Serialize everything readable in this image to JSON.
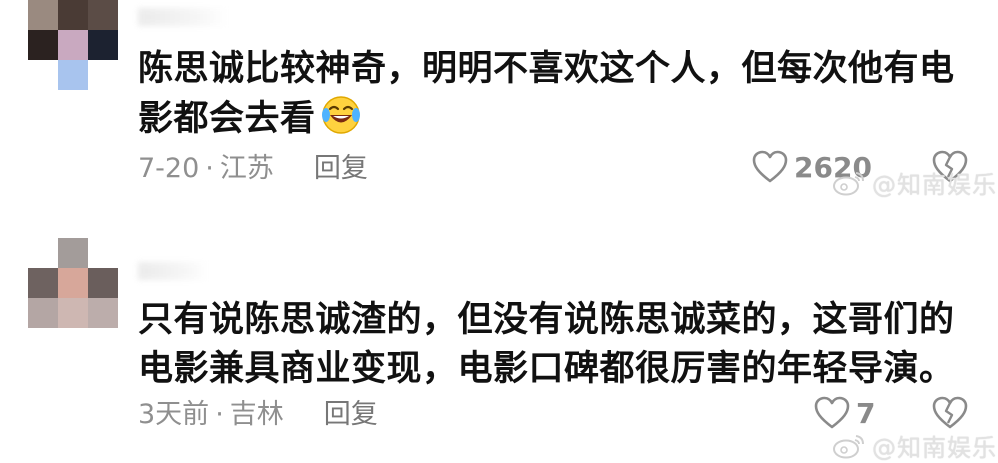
{
  "comments": [
    {
      "text_line1": "陈思诚比较神奇，明明不喜欢这个人，但每次他有电",
      "text_line2": "影都会去看",
      "emoji": "laughing-crying-emoji",
      "date": "7-20",
      "separator": "·",
      "location": "江苏",
      "reply_label": "回复",
      "like_count": "2620"
    },
    {
      "text_line1": "只有说陈思诚渣的，但没有说陈思诚菜的，这哥们的",
      "text_line2": "电影兼具商业变现，电影口碑都很厉害的年轻导演。",
      "date": "3天前",
      "separator": "·",
      "location": "吉林",
      "reply_label": "回复",
      "like_count": "7"
    }
  ],
  "watermark": {
    "text": "@知南娱乐",
    "icon": "weibo-logo-icon"
  },
  "colors": {
    "text": "#111111",
    "meta": "#8f8f8f",
    "icon": "#8a8a8a",
    "watermark": "#e2e2e2"
  }
}
